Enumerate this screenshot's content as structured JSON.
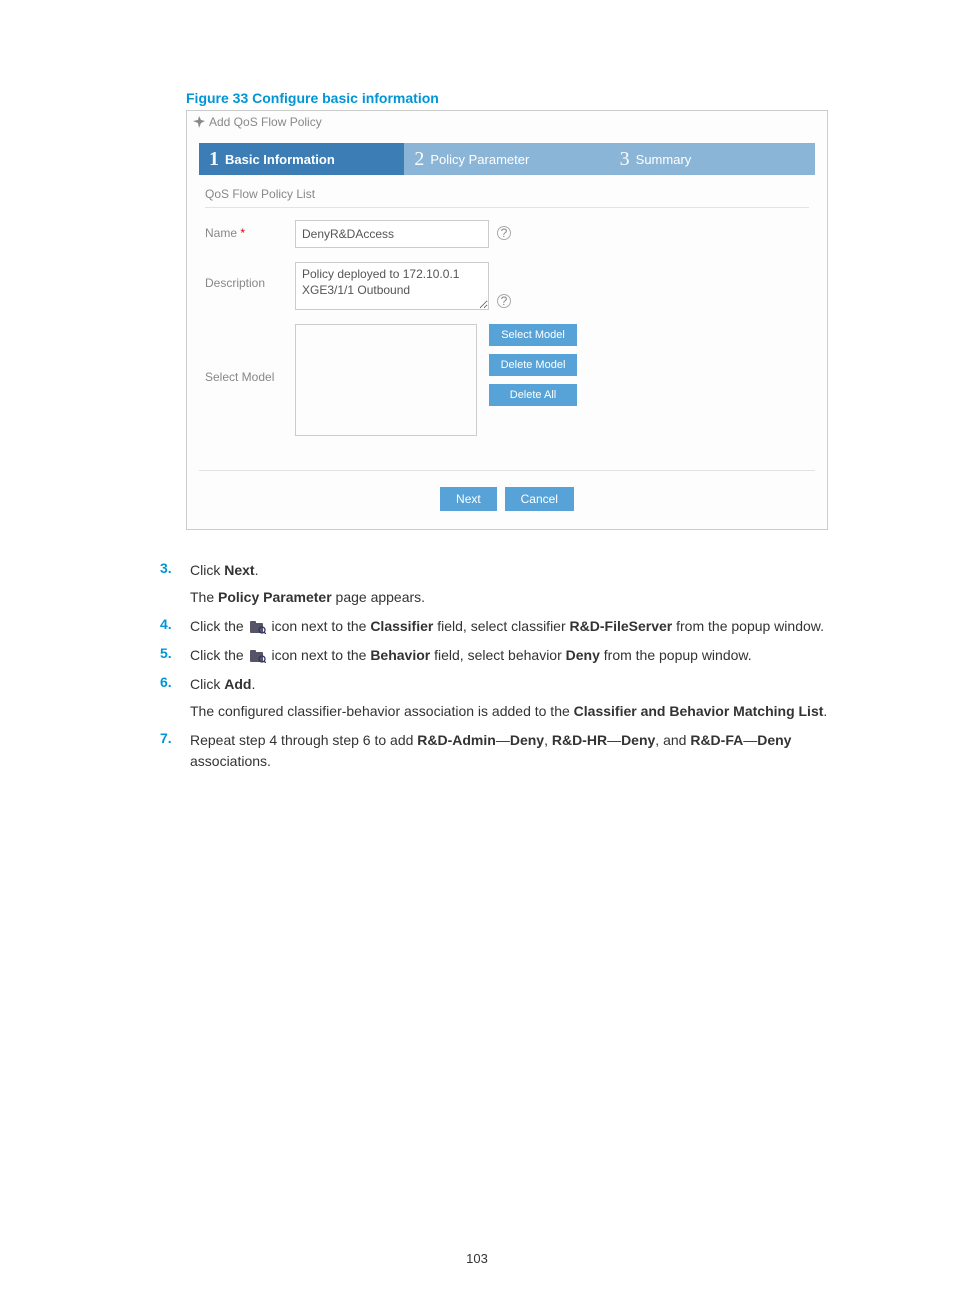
{
  "figure_caption": "Figure 33 Configure basic information",
  "panel": {
    "header": "Add QoS Flow Policy",
    "tabs": [
      {
        "num": "1",
        "label": "Basic Information"
      },
      {
        "num": "2",
        "label": "Policy Parameter"
      },
      {
        "num": "3",
        "label": "Summary"
      }
    ],
    "subheader": "QoS Flow Policy List",
    "fields": {
      "name_label": "Name",
      "name_value": "DenyR&DAccess",
      "desc_label": "Description",
      "desc_value": "Policy deployed to 172.10.0.1 XGE3/1/1 Outbound",
      "model_label": "Select Model"
    },
    "model_buttons": {
      "select": "Select Model",
      "delete": "Delete Model",
      "delete_all": "Delete All"
    },
    "footer": {
      "next": "Next",
      "cancel": "Cancel"
    }
  },
  "steps": {
    "s3a": "Click ",
    "s3b": "Next",
    "s3c": ".",
    "s3sub_a": "The ",
    "s3sub_b": "Policy Parameter",
    "s3sub_c": " page appears.",
    "s4a": "Click the ",
    "s4b": " icon next to the ",
    "s4c": "Classifier",
    "s4d": " field, select classifier ",
    "s4e": "R&D-FileServer",
    "s4f": " from the popup window.",
    "s5a": "Click the ",
    "s5b": " icon next to the ",
    "s5c": "Behavior",
    "s5d": " field, select behavior ",
    "s5e": "Deny",
    "s5f": " from the popup window.",
    "s6a": "Click ",
    "s6b": "Add",
    "s6c": ".",
    "s6sub_a": "The configured classifier-behavior association is added to the ",
    "s6sub_b": "Classifier and Behavior Matching List",
    "s6sub_c": ".",
    "s7a": "Repeat step 4 through step 6 to add ",
    "s7b": "R&D-Admin",
    "s7c": "—",
    "s7d": "Deny",
    "s7e": ", ",
    "s7f": "R&D-HR",
    "s7g": "—",
    "s7h": "Deny",
    "s7i": ", and ",
    "s7j": "R&D-FA",
    "s7k": "—",
    "s7l": "Deny",
    "s7m": " associations."
  },
  "step_numbers": {
    "n3": "3.",
    "n4": "4.",
    "n5": "5.",
    "n6": "6.",
    "n7": "7."
  },
  "page_number": "103"
}
